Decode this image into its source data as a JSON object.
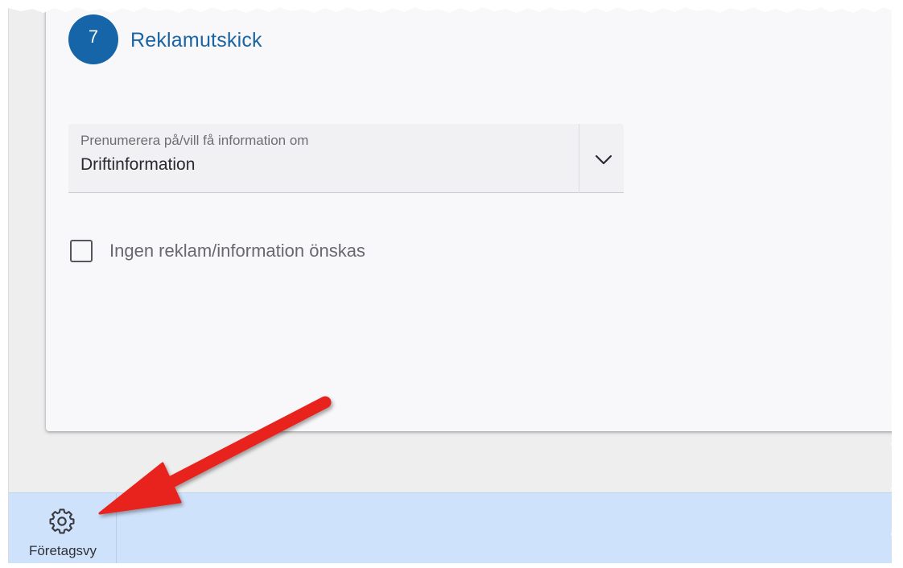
{
  "section": {
    "step_number": "7",
    "title": "Reklamutskick"
  },
  "subscription_select": {
    "label": "Prenumerera på/vill få information om",
    "selected_value": "Driftinformation",
    "icon": "chevron-down-icon"
  },
  "no_ads_checkbox": {
    "label": "Ingen reklam/information önskas",
    "checked": false
  },
  "bottom_nav": {
    "items": [
      {
        "label": "Företagsvy",
        "icon": "gear-icon"
      }
    ]
  },
  "colors": {
    "accent": "#1565a8",
    "title": "#1a64a3",
    "bottom_bar": "#cfe2fb",
    "annotation_arrow": "#e8231c"
  }
}
